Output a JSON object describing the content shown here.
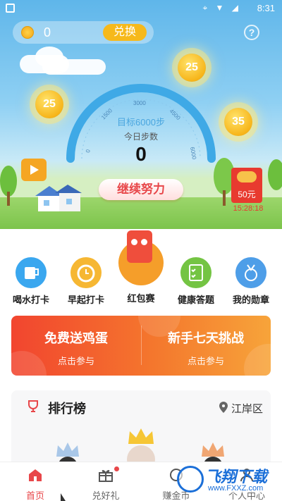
{
  "status_bar": {
    "time": "8:31"
  },
  "coins": {
    "count": "0",
    "exchange_label": "兑换",
    "help_label": "?"
  },
  "floating_coins": [
    "25",
    "25",
    "35"
  ],
  "gauge": {
    "ticks": [
      "0",
      "1500",
      "3000",
      "4500",
      "6000"
    ],
    "target": "目标6000步",
    "label": "今日步数",
    "steps": "0"
  },
  "keep_going_label": "继续努力",
  "redpacket": {
    "amount": "50元",
    "countdown": "15:28:18"
  },
  "features": [
    {
      "label": "喝水打卡",
      "icon": "cup-icon",
      "color": "#3aa7ef"
    },
    {
      "label": "早起打卡",
      "icon": "alarm-clock-icon",
      "color": "#f6b733"
    },
    {
      "label": "红包赛",
      "icon": "red-packet-mascot-icon",
      "color": "#f59e2a"
    },
    {
      "label": "健康答题",
      "icon": "quiz-checklist-icon",
      "color": "#74c443"
    },
    {
      "label": "我的勋章",
      "icon": "medal-icon",
      "color": "#4e9ee8"
    }
  ],
  "banner": {
    "left": {
      "title": "免费送鸡蛋",
      "subtitle": "点击参与"
    },
    "right": {
      "title": "新手七天挑战",
      "subtitle": "点击参与"
    }
  },
  "ranking": {
    "title": "排行榜",
    "location": "江岸区"
  },
  "tabs": [
    {
      "label": "首页",
      "icon": "home-icon",
      "active": true
    },
    {
      "label": "兑好礼",
      "icon": "gift-icon",
      "active": false
    },
    {
      "label": "赚金币",
      "icon": "coin-icon",
      "active": false
    },
    {
      "label": "个人中心",
      "icon": "person-icon",
      "active": false
    }
  ],
  "watermark": {
    "title": "飞翔下载",
    "url": "www.FXXZ.com"
  },
  "colors": {
    "accent": "#e8474a",
    "sky": "#5fb6ea",
    "coin": "#f7b51a"
  }
}
